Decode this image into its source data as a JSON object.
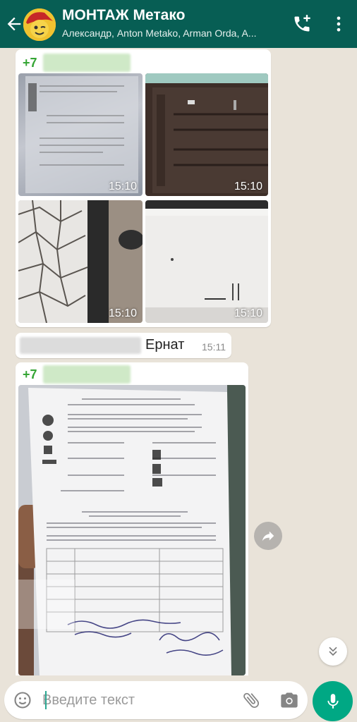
{
  "header": {
    "title": "МОНТАЖ Метако",
    "subtitle": "Александр, Anton Metako, Arman Orda, A..."
  },
  "messages": {
    "photo_group": {
      "sender_prefix": "+7",
      "photos": [
        {
          "time": "15:10"
        },
        {
          "time": "15:10"
        },
        {
          "time": "15:10"
        },
        {
          "time": "15:10"
        }
      ]
    },
    "text_message": {
      "name": "Ернат",
      "time": "15:11"
    },
    "doc_photo": {
      "sender_prefix": "+7"
    }
  },
  "composer": {
    "placeholder": "Введите текст"
  },
  "colors": {
    "header": "#075e54",
    "accent": "#00a884",
    "sender": "#35a535",
    "chat_bg": "#e9e3d9"
  },
  "icons": [
    "back-arrow-icon",
    "add-call-icon",
    "more-vert-icon",
    "emoji-icon",
    "attach-icon",
    "camera-icon",
    "mic-icon",
    "forward-icon",
    "chevron-double-down-icon"
  ]
}
